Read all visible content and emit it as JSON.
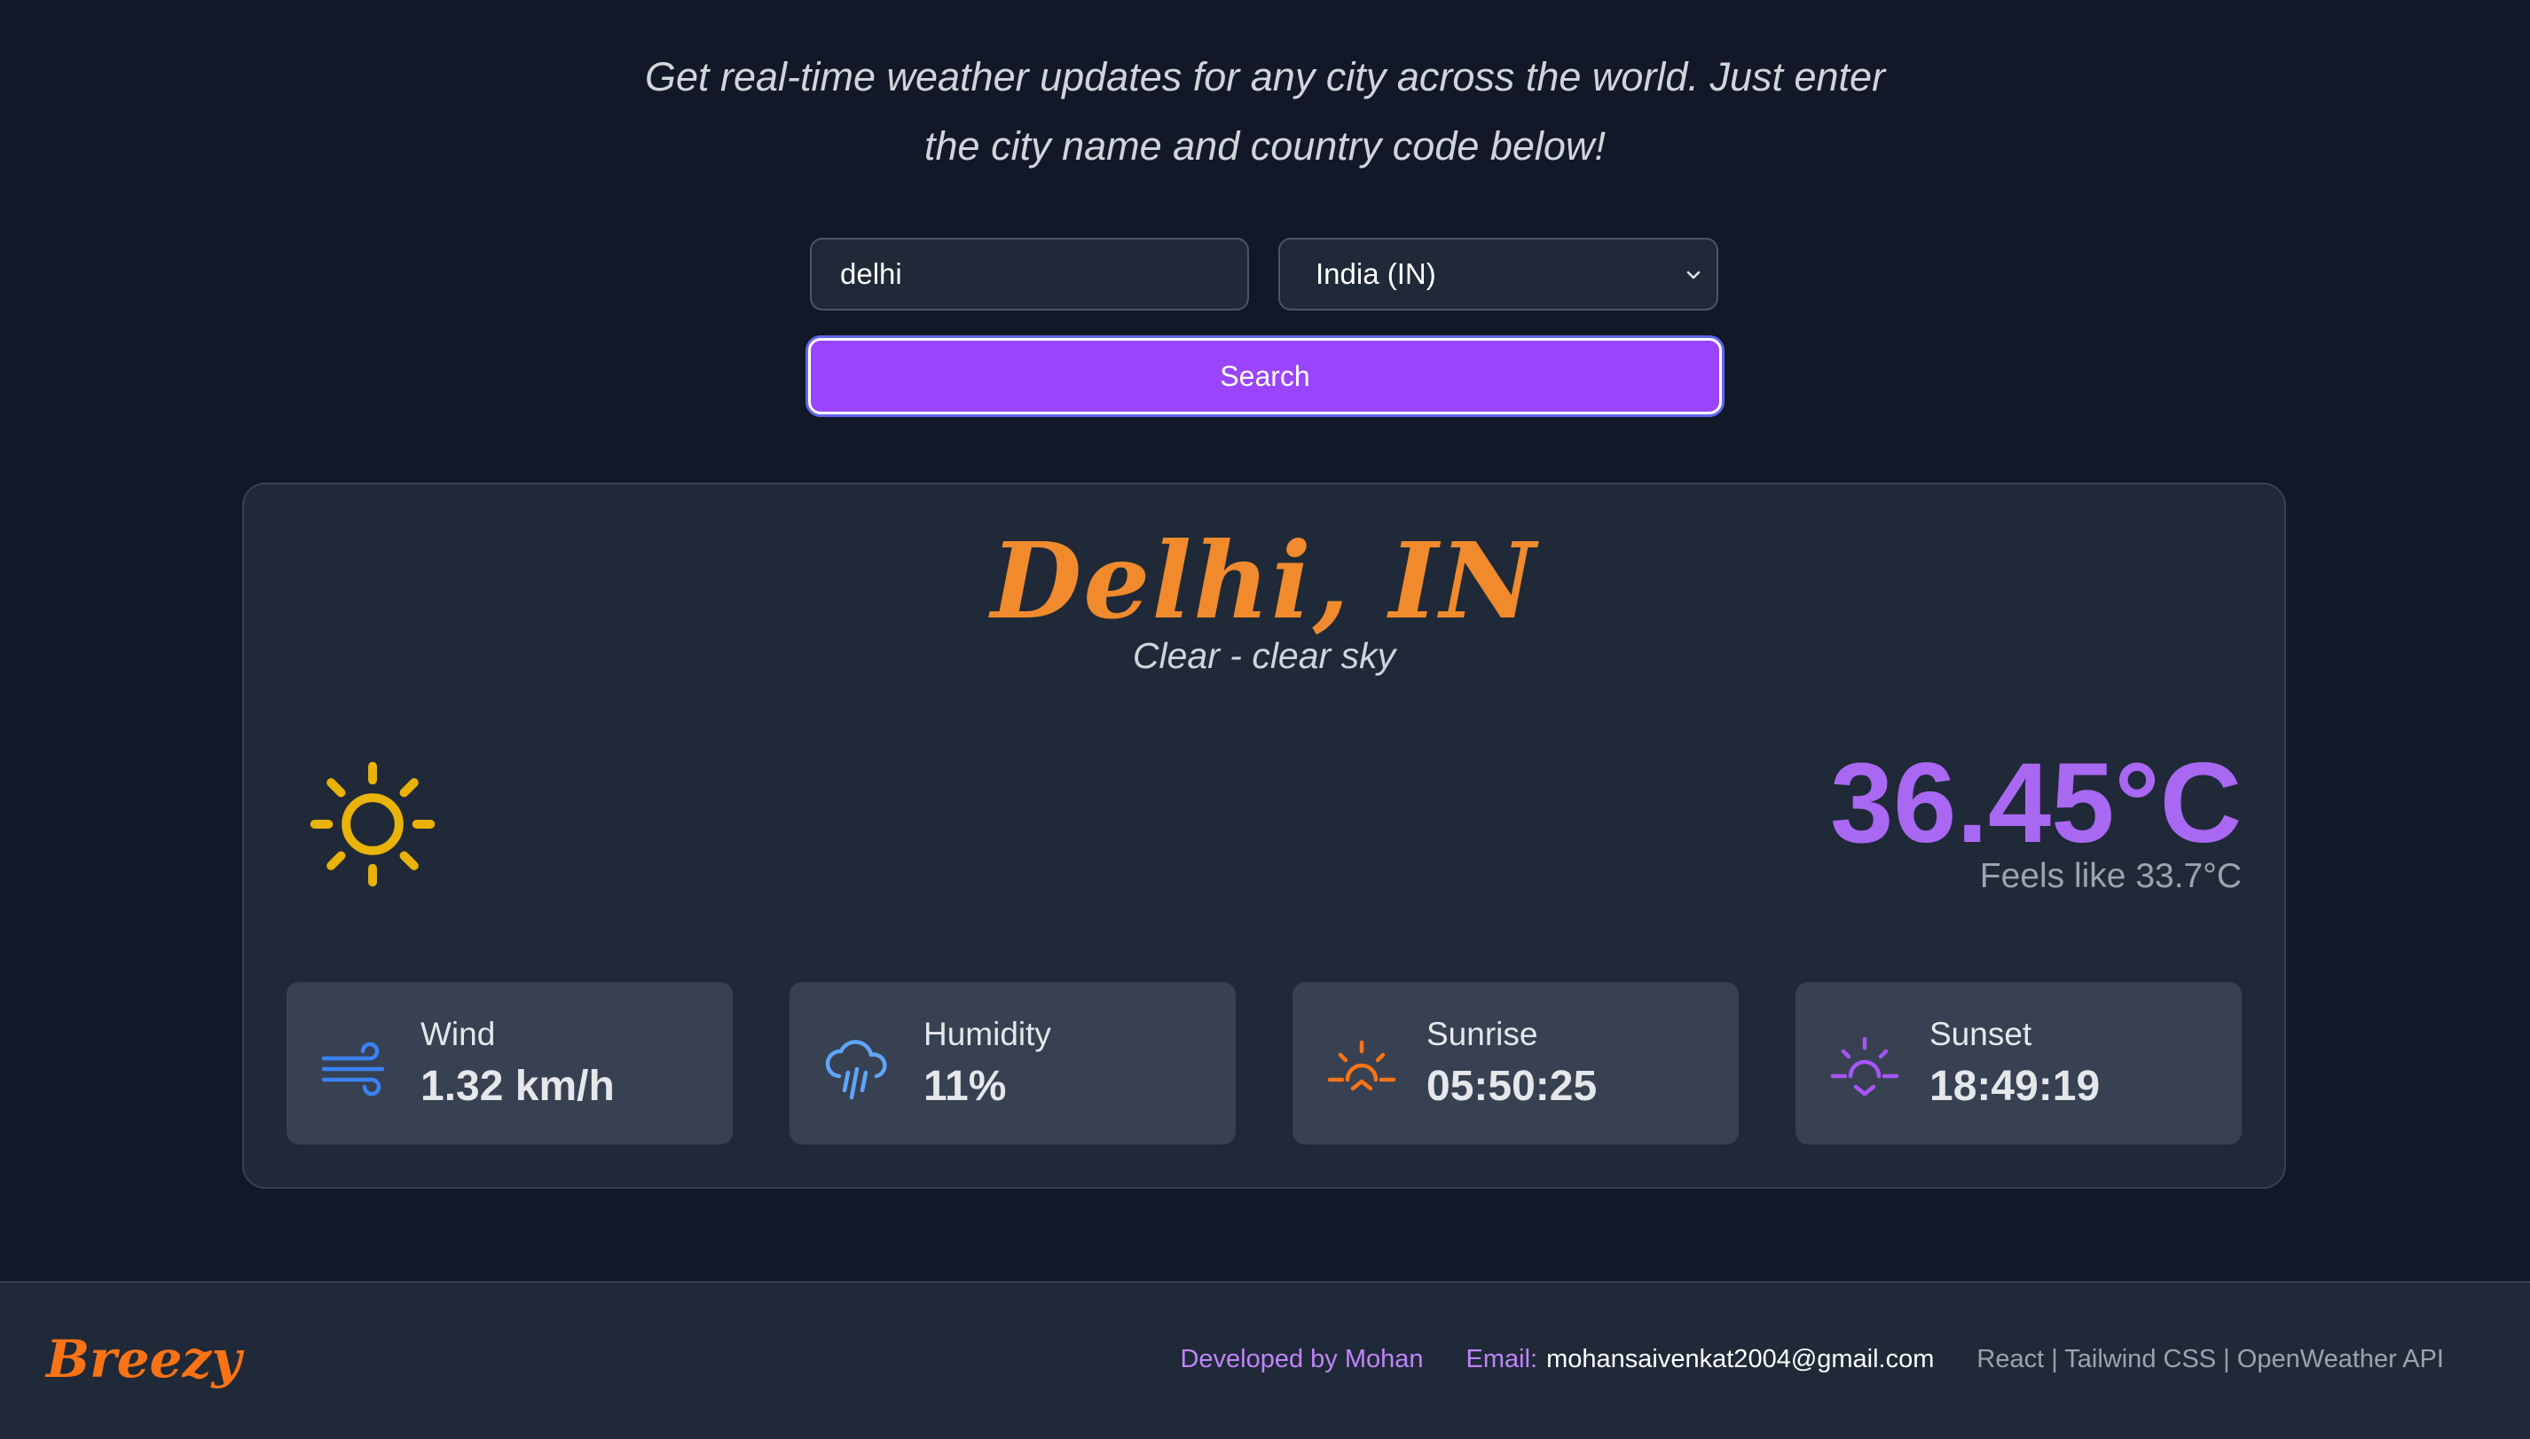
{
  "intro": {
    "line1": "Get real-time weather updates for any city across the world. Just enter",
    "line2": "the city name and country code below!"
  },
  "search": {
    "city_value": "delhi",
    "country_selected": "India (IN)",
    "button_label": "Search"
  },
  "weather": {
    "city": "Delhi, IN",
    "condition": "Clear - clear sky",
    "icon": "sun-icon",
    "temperature": "36.45°C",
    "feels_like": "Feels like 33.7°C"
  },
  "stats": {
    "wind": {
      "label": "Wind",
      "value": "1.32 km/h",
      "icon": "wind-icon"
    },
    "humidity": {
      "label": "Humidity",
      "value": "11%",
      "icon": "cloud-rain-icon"
    },
    "sunrise": {
      "label": "Sunrise",
      "value": "05:50:25",
      "icon": "sunrise-icon"
    },
    "sunset": {
      "label": "Sunset",
      "value": "18:49:19",
      "icon": "sunset-icon"
    }
  },
  "footer": {
    "brand": "Breezy",
    "developer": "Developed by Mohan",
    "email_label": "Email:",
    "email_value": "mohansaivenkat2004@gmail.com",
    "tech": "React | Tailwind CSS | OpenWeather API"
  },
  "colors": {
    "background": "#121827",
    "card": "#1f2937",
    "stat_card": "#374151",
    "accent_purple": "#9a45fb",
    "temperature": "#a968f2",
    "city_orange": "#f08a2c",
    "sun_yellow": "#eab308",
    "wind_blue": "#3b82f6",
    "humidity_blue": "#60a5fa",
    "sunrise_orange": "#f97316",
    "sunset_purple": "#a855f7"
  }
}
